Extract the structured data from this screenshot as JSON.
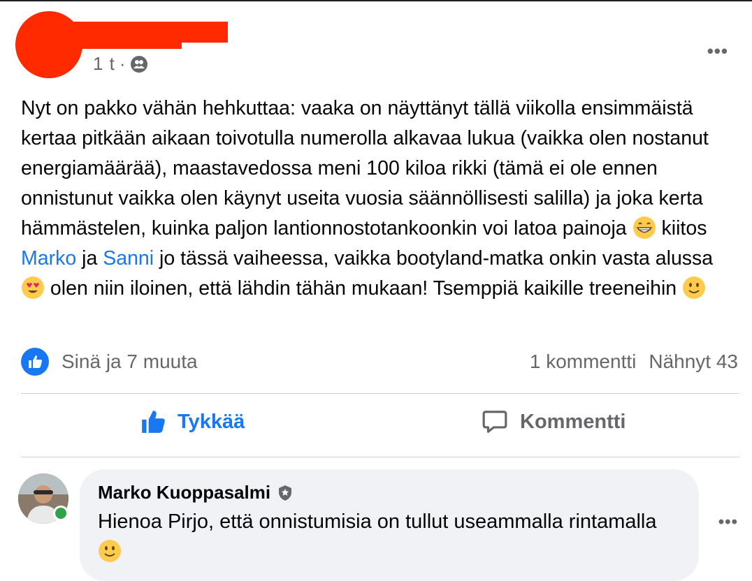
{
  "post": {
    "time": "1 t",
    "meta_separator": "·",
    "privacy_icon": "friends-icon",
    "more_label": "•••",
    "text_parts": {
      "p1": "Nyt on pakko vähän hehkuttaa: vaaka on näyttänyt tällä viikolla ensimmäistä kertaa pitkään aikaan toivotulla numerolla alkavaa lukua (vaikka olen nostanut energiamäärää), maastavedossa meni 100 kiloa rikki (tämä ei ole ennen onnistunut vaikka olen käynyt useita vuosia säännöllisesti salilla) ja joka kerta hämmästelen, kuinka paljon lantionnostotankoonkin voi latoa painoja",
      "p2": " kiitos ",
      "mention1": "Marko",
      "p3": " ja ",
      "mention2": "Sanni",
      "p4": " jo tässä vaiheessa, vaikka bootyland-matka onkin vasta alussa",
      "p5": " olen niin iloinen, että lähdin tähän mukaan! Tsemppiä kaikille treeneihin"
    },
    "emojis": [
      "grinning-face",
      "heart-eyes-face",
      "slightly-smiling-face"
    ]
  },
  "reactions": {
    "summary": "Sinä ja 7 muuta",
    "comments": "1 kommentti",
    "seen": "Nähnyt 43"
  },
  "actions": {
    "like_label": "Tykkää",
    "comment_label": "Kommentti"
  },
  "comment": {
    "author": "Marko Kuoppasalmi",
    "text": "Hienoa Pirjo, että onnistumisia on tullut useammalla rintamalla",
    "more_label": "•••",
    "badge_icon": "shield-badge-icon"
  },
  "colors": {
    "accent": "#1877f2",
    "secondary_text": "#65676b",
    "bubble": "#f0f2f5",
    "online": "#31a24c"
  }
}
